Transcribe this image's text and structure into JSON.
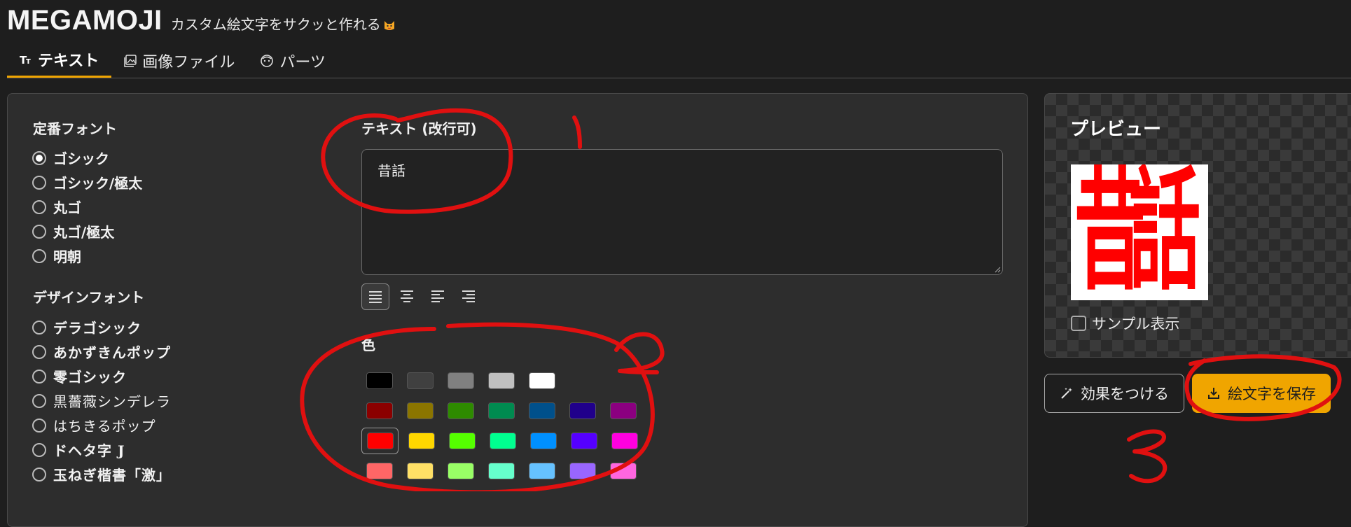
{
  "app": {
    "title": "MEGAMOJI",
    "tagline": "カスタム絵文字をサクッと作れる"
  },
  "tabs": [
    {
      "label": "テキスト",
      "icon": "text-size-icon",
      "active": true
    },
    {
      "label": "画像ファイル",
      "icon": "image-icon",
      "active": false
    },
    {
      "label": "パーツ",
      "icon": "face-icon",
      "active": false
    }
  ],
  "fonts": {
    "standard_title": "定番フォント",
    "standard": [
      {
        "label": "ゴシック",
        "checked": true
      },
      {
        "label": "ゴシック/極太",
        "checked": false
      },
      {
        "label": "丸ゴ",
        "checked": false
      },
      {
        "label": "丸ゴ/極太",
        "checked": false
      },
      {
        "label": "明朝",
        "checked": false
      }
    ],
    "design_title": "デザインフォント",
    "design": [
      {
        "label": "デラゴシック"
      },
      {
        "label": "あかずきんポップ"
      },
      {
        "label": "零ゴシック"
      },
      {
        "label": "黒薔薇シンデレラ"
      },
      {
        "label": "はちきるポップ"
      },
      {
        "label": "ドヘタ字 J"
      },
      {
        "label": "玉ねぎ楷書「激」"
      }
    ]
  },
  "text_input": {
    "label": "テキスト (改行可)",
    "value": "昔話"
  },
  "alignment": {
    "options": [
      "justify-align-icon",
      "center-align-icon",
      "left-align-icon",
      "right-align-icon"
    ],
    "selected": "justify-align-icon"
  },
  "color": {
    "label": "色",
    "rows": [
      [
        "#000000",
        "#404040",
        "#808080",
        "#c0c0c0",
        "#ffffff"
      ],
      [
        "#8b0000",
        "#8b7500",
        "#2e8b00",
        "#008b50",
        "#00508b",
        "#20008b",
        "#8b0080"
      ],
      [
        "#ff0000",
        "#ffd700",
        "#55ff00",
        "#00ff90",
        "#0090ff",
        "#5500ff",
        "#ff00e0"
      ],
      [
        "#ff6666",
        "#ffe066",
        "#99ff66",
        "#66ffcc",
        "#66c2ff",
        "#9966ff",
        "#ff66e0"
      ]
    ],
    "selected": "#ff0000"
  },
  "preview": {
    "title": "プレビュー",
    "emoji_text": "昔話",
    "emoji_color": "#ff0000",
    "sample_label": "サンプル表示"
  },
  "actions": {
    "effect_label": "効果をつける",
    "save_label": "絵文字を保存"
  },
  "accent_color": "#f0a500"
}
